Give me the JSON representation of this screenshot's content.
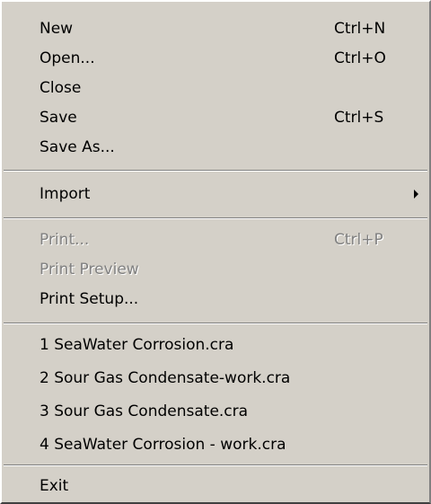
{
  "menu": {
    "new": {
      "label": "New",
      "shortcut": "Ctrl+N"
    },
    "open": {
      "label": "Open...",
      "shortcut": "Ctrl+O"
    },
    "close": {
      "label": "Close"
    },
    "save": {
      "label": "Save",
      "shortcut": "Ctrl+S"
    },
    "save_as": {
      "label": "Save As..."
    },
    "import": {
      "label": "Import",
      "submenu_icon": "submenu-arrow-icon"
    },
    "print": {
      "label": "Print...",
      "shortcut": "Ctrl+P",
      "disabled": true
    },
    "print_preview": {
      "label": "Print Preview",
      "disabled": true
    },
    "print_setup": {
      "label": "Print Setup..."
    },
    "recent_files": [
      "1 SeaWater Corrosion.cra",
      "2 Sour Gas Condensate-work.cra",
      "3 Sour Gas Condensate.cra",
      "4 SeaWater Corrosion - work.cra"
    ],
    "exit": {
      "label": "Exit"
    }
  },
  "colors": {
    "menu_background": "#d4d0c8",
    "text": "#000000",
    "disabled_text": "#808080",
    "separator_dark": "#808080",
    "separator_light": "#ffffff"
  }
}
